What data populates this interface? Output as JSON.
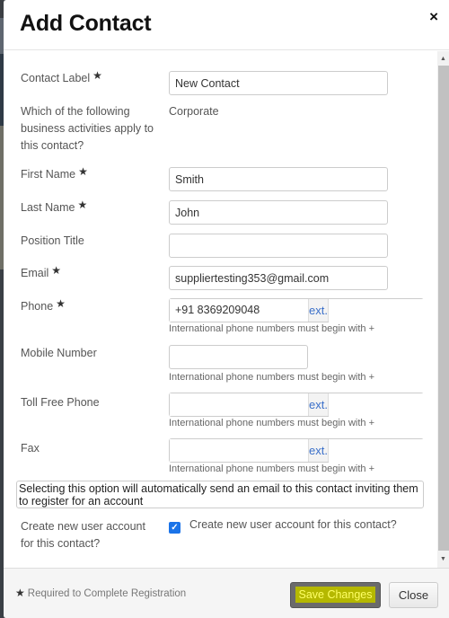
{
  "modal": {
    "title": "Add Contact",
    "close_icon": "×"
  },
  "form": {
    "contact_label": {
      "label": "Contact Label",
      "required": true,
      "value": "New Contact"
    },
    "business_activities": {
      "label_lines": [
        "Which of the following",
        "business activities apply to",
        "this contact?"
      ],
      "value": "Corporate"
    },
    "first_name": {
      "label": "First Name",
      "required": true,
      "value": "Smith"
    },
    "last_name": {
      "label": "Last Name",
      "required": true,
      "value": "John"
    },
    "position_title": {
      "label": "Position Title",
      "required": false,
      "value": ""
    },
    "email": {
      "label": "Email",
      "required": true,
      "value": "suppliertesting353@gmail.com"
    },
    "phone": {
      "label": "Phone",
      "required": true,
      "value": "+91 8369209048",
      "ext_label": "ext.",
      "ext_value": "",
      "help": "International phone numbers must begin with +"
    },
    "mobile": {
      "label": "Mobile Number",
      "required": false,
      "value": "",
      "help": "International phone numbers must begin with +"
    },
    "toll_free": {
      "label": "Toll Free Phone",
      "required": false,
      "value": "",
      "ext_label": "ext.",
      "ext_value": "",
      "help": "International phone numbers must begin with +"
    },
    "fax": {
      "label": "Fax",
      "required": false,
      "value": "",
      "ext_label": "ext.",
      "ext_value": "",
      "help": "International phone numbers must begin with +"
    },
    "notice": "Selecting this option will automatically send an email to this contact inviting them to register for an account",
    "create_account": {
      "label_lines": [
        "Create new user account",
        "for this contact?"
      ],
      "checked": true,
      "checkbox_label": "Create new user account for this contact?"
    },
    "required_star": "★"
  },
  "footer": {
    "required_note": "Required to Complete Registration",
    "save_label": "Save Changes",
    "close_label": "Close"
  },
  "scrollbar": {
    "up_icon": "▲",
    "down_icon": "▼"
  },
  "colors": {
    "link_blue": "#3a6fc9",
    "checkbox_blue": "#1a73e8",
    "highlight": "#b5b800"
  }
}
